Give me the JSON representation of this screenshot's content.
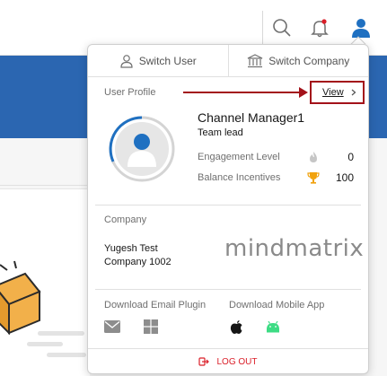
{
  "header": {
    "icons": [
      "search-icon",
      "bell-icon",
      "user-icon"
    ],
    "notification_dot_color": "#da1e28"
  },
  "popover": {
    "switch_user_label": "Switch User",
    "switch_company_label": "Switch Company",
    "user_profile_label": "User Profile",
    "view_label": "View",
    "profile": {
      "name": "Channel Manager1",
      "role": "Team lead",
      "engagement_label": "Engagement Level",
      "engagement_value": "0",
      "balance_label": "Balance Incentives",
      "balance_value": "100"
    },
    "company": {
      "label": "Company",
      "name_line1": "Yugesh Test",
      "name_line2": "Company 1002",
      "logo_text": "mindmatrix"
    },
    "downloads": {
      "email_plugin_label": "Download Email Plugin",
      "mobile_app_label": "Download Mobile App",
      "icons": [
        "mail-icon",
        "windows-icon",
        "apple-icon",
        "android-icon"
      ]
    },
    "logout_label": "LOG OUT"
  },
  "colors": {
    "banner": "#2b66b1",
    "accent_blue": "#1f70c1",
    "highlight_red": "#a3121a",
    "logout_red": "#da1e28",
    "trophy": "#f1a20d",
    "android": "#3ddc84"
  }
}
